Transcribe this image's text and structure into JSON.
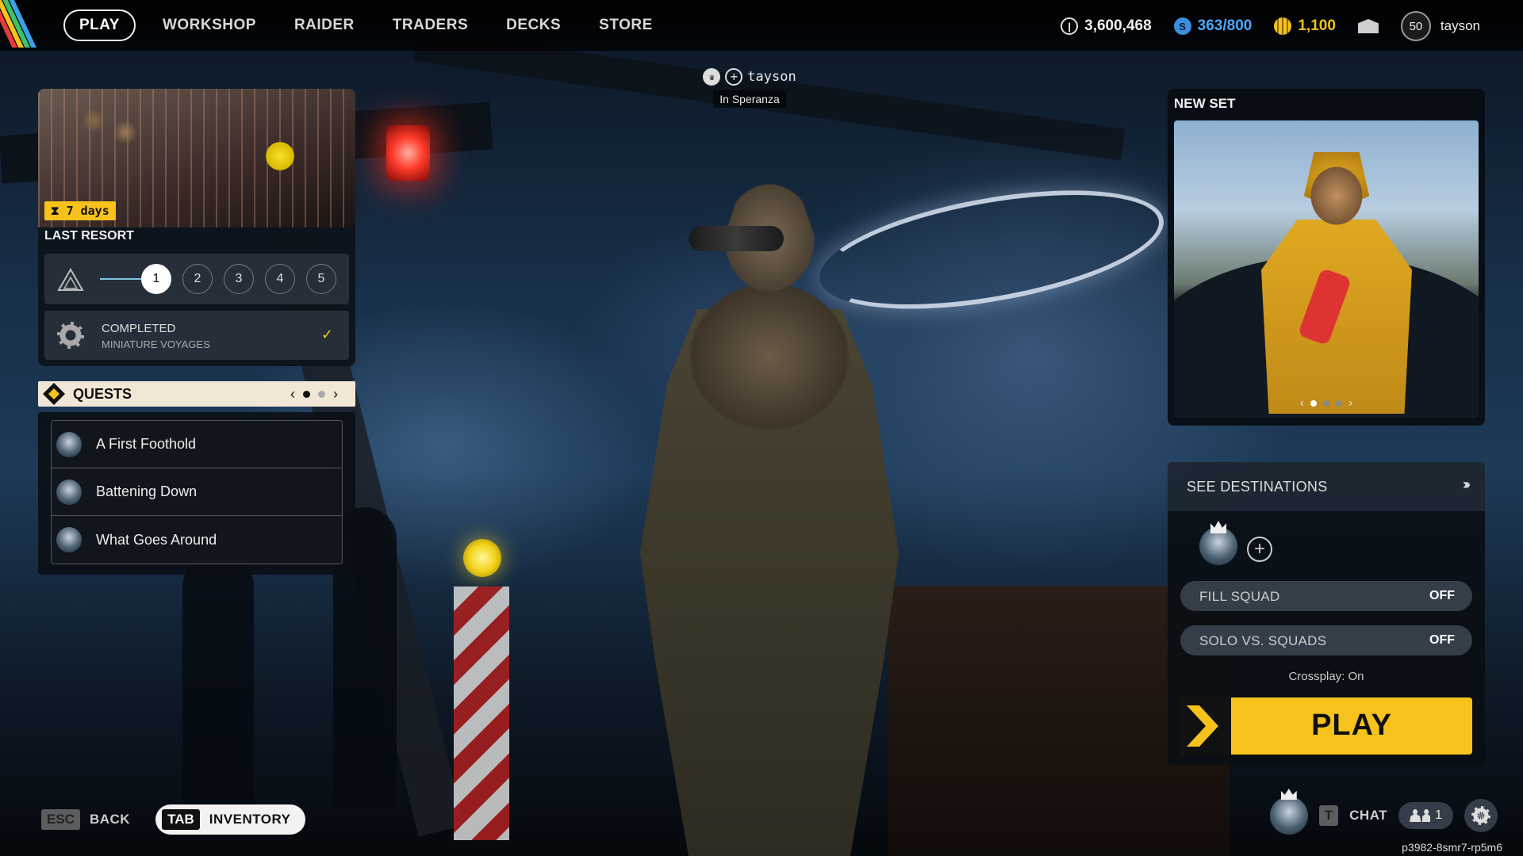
{
  "colors": {
    "accent": "#f6c21b",
    "seeds": "#4aa8ff",
    "panel": "#0a0e14"
  },
  "nav": {
    "items": [
      {
        "label": "PLAY",
        "active": true
      },
      {
        "label": "WORKSHOP"
      },
      {
        "label": "RAIDER"
      },
      {
        "label": "TRADERS"
      },
      {
        "label": "DECKS"
      },
      {
        "label": "STORE"
      }
    ]
  },
  "currencies": {
    "coins": "3,600,468",
    "seeds": "363/800",
    "tokens": "1,100"
  },
  "profile": {
    "level": "50",
    "name": "tayson"
  },
  "party": {
    "name": "tayson",
    "status": "In Speranza"
  },
  "event": {
    "days": "7 days",
    "title": "LAST RESORT",
    "steps": [
      "1",
      "2",
      "3",
      "4",
      "5"
    ],
    "current_step": "1",
    "completed_title": "COMPLETED",
    "completed_sub": "MINIATURE VOYAGES"
  },
  "quests": {
    "title": "QUESTS",
    "page": 1,
    "pages": 2,
    "items": [
      "A First Foothold",
      "Battening Down",
      "What Goes Around"
    ]
  },
  "new_set": {
    "title": "NEW SET",
    "page": 1,
    "pages": 3
  },
  "play_panel": {
    "destinations_label": "SEE DESTINATIONS",
    "fill_squad_label": "FILL SQUAD",
    "fill_squad_value": "OFF",
    "solo_label": "SOLO VS. SQUADS",
    "solo_value": "OFF",
    "crossplay": "Crossplay: On",
    "play_label": "PLAY"
  },
  "bottom": {
    "esc_key": "ESC",
    "back_label": "BACK",
    "tab_key": "TAB",
    "inventory_label": "INVENTORY",
    "chat_key": "T",
    "chat_label": "CHAT",
    "friends_count": "1",
    "build_id": "p3982-8smr7-rp5m6"
  }
}
